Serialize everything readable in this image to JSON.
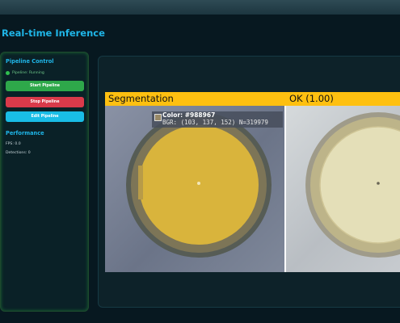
{
  "page": {
    "title": "Real-time Inference"
  },
  "sidebar": {
    "pipeline_title": "Pipeline Control",
    "status": {
      "text": "Pipeline: Running",
      "color": "#2fbf4e"
    },
    "buttons": {
      "start": "Start Pipeline",
      "stop": "Stop Pipeline",
      "edit": "Edit Pipeline"
    },
    "performance_title": "Performance",
    "fps": "FPS: 0.0",
    "detections": "Detections: 0"
  },
  "viewer": {
    "left_label": "Segmentation",
    "right_label": "OK (1.00)",
    "info": {
      "color_label": "Color: #988967",
      "bgr_label": "BGR: (103, 137, 152)  N=319979",
      "swatch_color": "#988967"
    }
  },
  "colors": {
    "accent": "#1fb6e8",
    "start": "#2ea84a",
    "stop": "#d93a4a",
    "edit": "#19bde6",
    "header_strip": "#fec010",
    "segmentation_fill": "#d9b43c"
  }
}
